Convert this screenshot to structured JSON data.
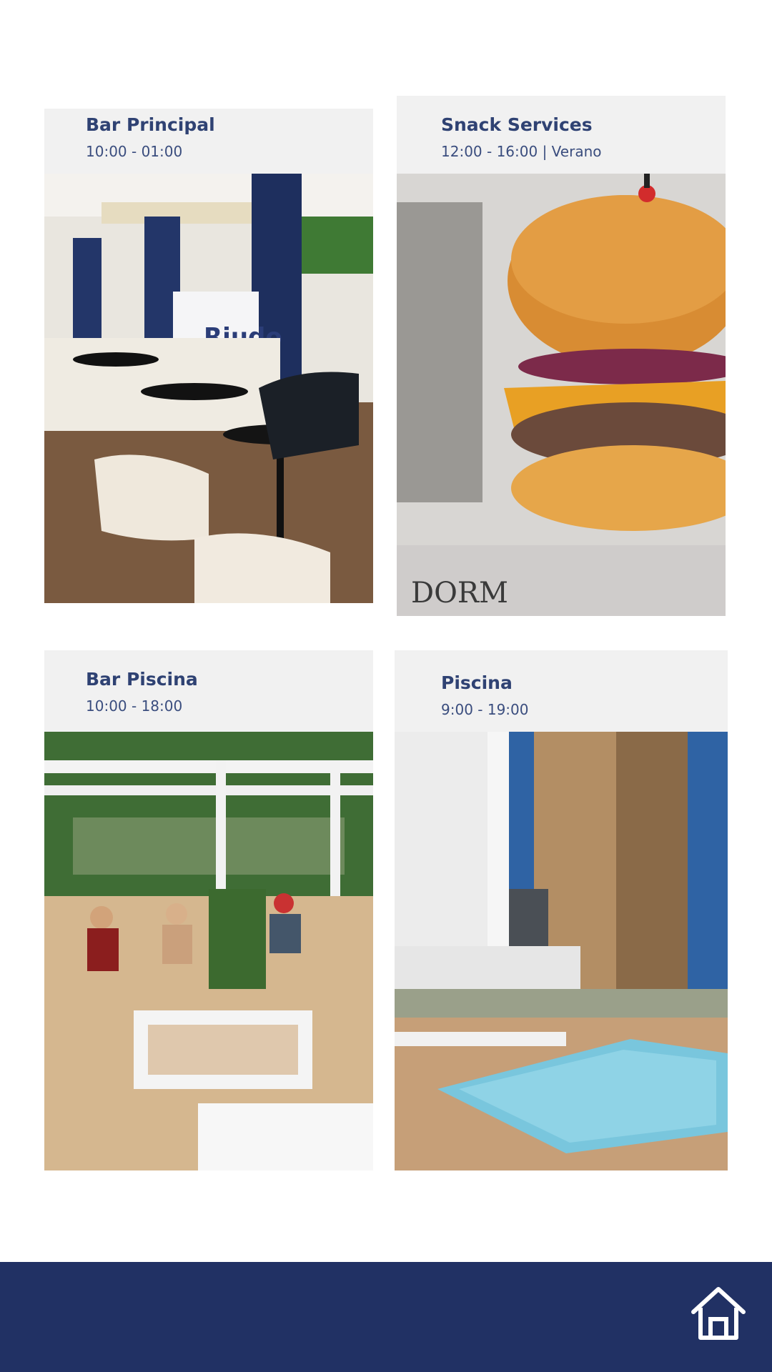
{
  "cards": [
    {
      "title": "Bar Principal",
      "hours": "10:00 - 01:00"
    },
    {
      "title": "Snack Services",
      "hours": "12:00 - 16:00 | Verano"
    },
    {
      "title": "Bar Piscina",
      "hours": "10:00 - 18:00"
    },
    {
      "title": "Piscina",
      "hours": "9:00 - 19:00"
    }
  ],
  "photo_sign_text": "Riudo",
  "footer": {
    "home_icon": "home-icon",
    "background": "#213164"
  },
  "colors": {
    "title": "#2f4273",
    "caption_bg": "#f0f0f0"
  }
}
